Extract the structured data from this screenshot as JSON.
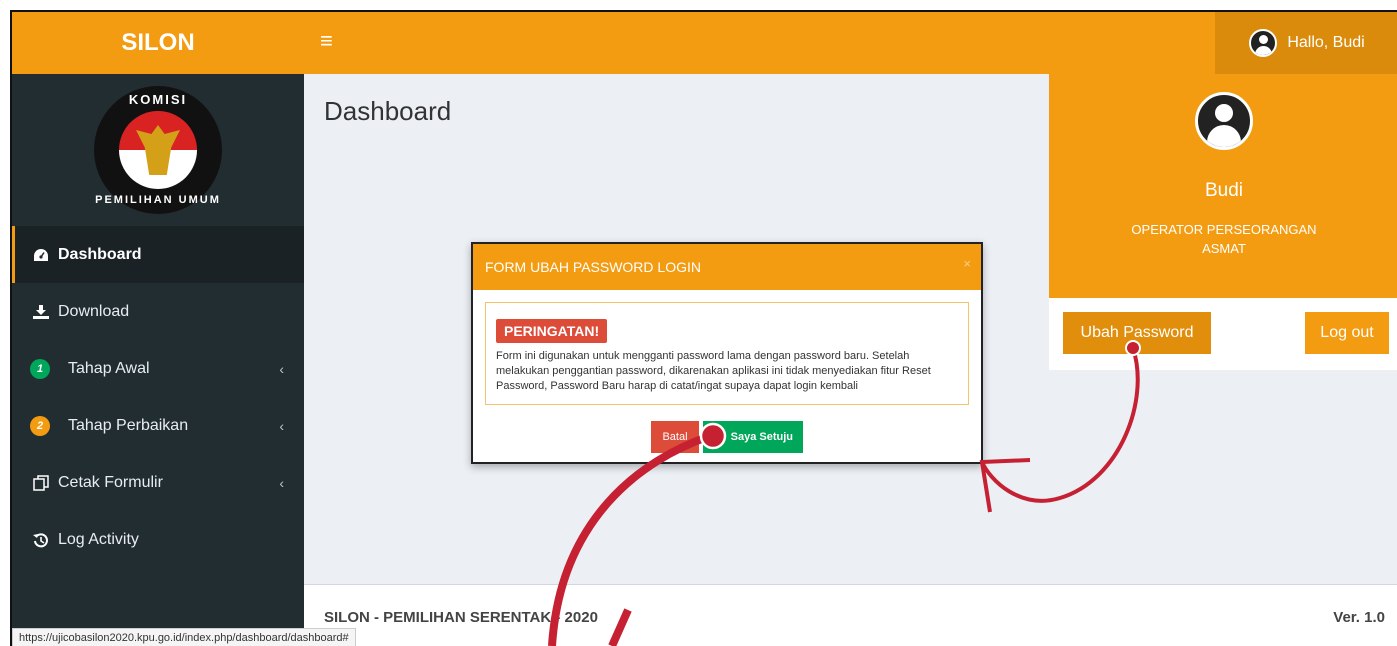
{
  "app": {
    "logo_text": "SILON"
  },
  "header": {
    "greeting": "Hallo, Budi"
  },
  "sidebar": {
    "logo": {
      "top_text": "KOMISI",
      "bottom_text": "PEMILIHAN UMUM"
    },
    "items": [
      {
        "label": "Dashboard",
        "icon": "dashboard-icon"
      },
      {
        "label": "Download",
        "icon": "download-icon"
      },
      {
        "label": "Tahap Awal",
        "badge": "1"
      },
      {
        "label": "Tahap Perbaikan",
        "badge": "2"
      },
      {
        "label": "Cetak Formulir",
        "icon": "copy-icon"
      },
      {
        "label": "Log Activity",
        "icon": "history-icon"
      }
    ]
  },
  "main": {
    "title": "Dashboard"
  },
  "profile": {
    "name": "Budi",
    "role_line1": "OPERATOR PERSEORANGAN",
    "role_line2": "ASMAT",
    "change_password_label": "Ubah Password",
    "logout_label": "Log out"
  },
  "modal": {
    "title": "FORM UBAH PASSWORD LOGIN",
    "close": "×",
    "warning_label": "PERINGATAN!",
    "warning_text": "Form ini digunakan untuk mengganti password lama dengan password baru. Setelah melakukan penggantian password, dikarenakan aplikasi ini tidak menyediakan fitur Reset Password, Password Baru harap di catat/ingat supaya dapat login kembali",
    "cancel_label": "Batal",
    "agree_label": "Saya Setuju"
  },
  "footer": {
    "left": "SILON - PEMILIHAN SERENTAK - 2020",
    "right": "Ver. 1.0"
  },
  "status_bar": {
    "url": "https://ujicobasilon2020.kpu.go.id/index.php/dashboard/dashboard#"
  },
  "colors": {
    "accent": "#f39c12",
    "sidebar": "#222d32",
    "annotation": "#c62033"
  }
}
